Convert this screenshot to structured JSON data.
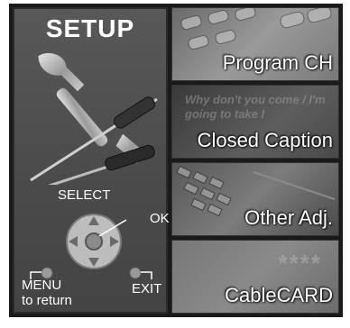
{
  "setup_panel": {
    "title": "SETUP",
    "select_label": "SELECT",
    "ok_label": "OK",
    "menu_label": "MENU",
    "menu_sub_label": "to return",
    "exit_label": "EXIT"
  },
  "menu": {
    "items": [
      {
        "label": "Program CH"
      },
      {
        "label": "Closed Caption",
        "background_text": "Why don't you come / I'm going to take l"
      },
      {
        "label": "Other Adj."
      },
      {
        "label": "CableCARD",
        "background_text": "****"
      }
    ]
  }
}
